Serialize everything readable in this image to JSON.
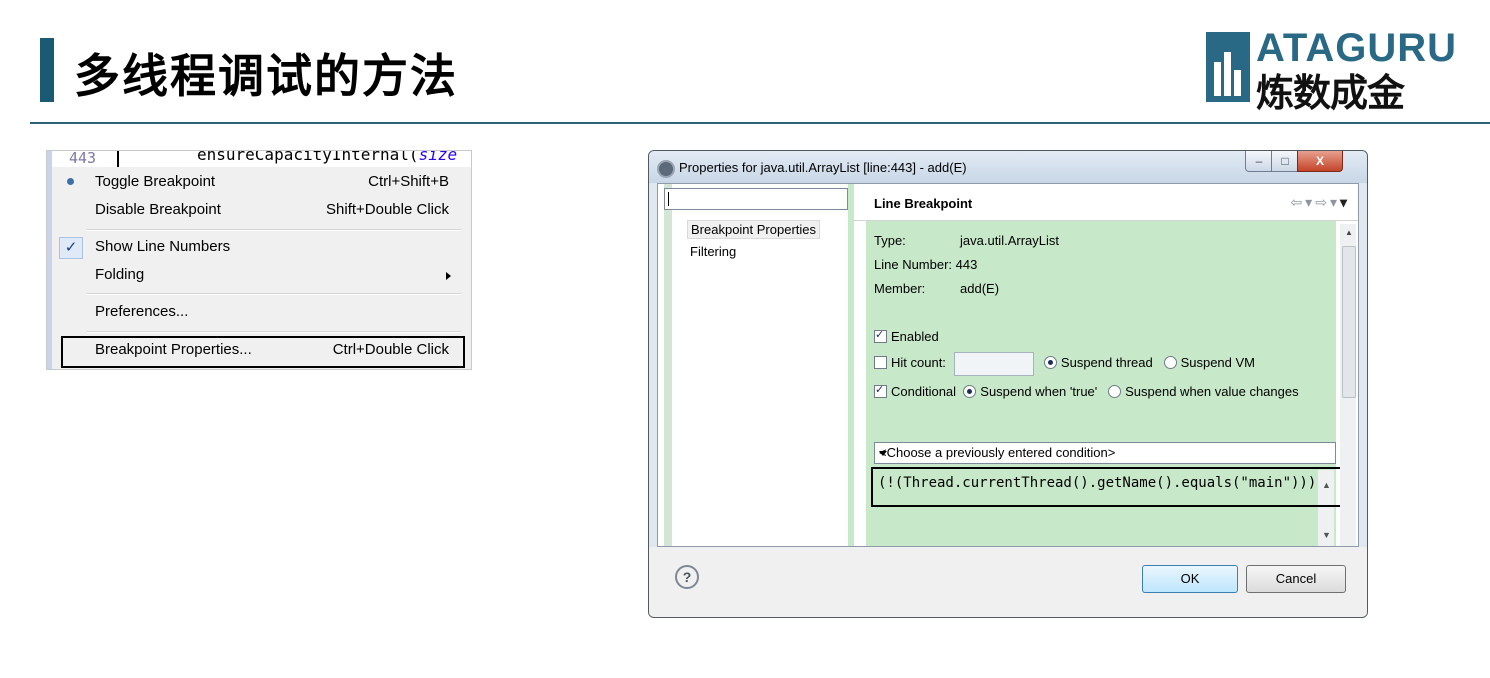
{
  "slide": {
    "title": "多线程调试的方法",
    "logo_en": "ATAGURU",
    "logo_cn": "炼数成金"
  },
  "context_menu": {
    "code_line_number": "443",
    "code_text": "ensureCapacityInternal(",
    "code_text_tail": "size",
    "items": [
      {
        "label": "Toggle Breakpoint",
        "shortcut": "Ctrl+Shift+B",
        "icon": "breakpoint-dot-icon"
      },
      {
        "label": "Disable Breakpoint",
        "shortcut": "Shift+Double Click"
      },
      {
        "label": "Show Line Numbers",
        "shortcut": "",
        "icon": "checkmark-icon",
        "checked": true
      },
      {
        "label": "Folding",
        "shortcut": "",
        "submenu": true
      },
      {
        "label": "Preferences...",
        "shortcut": ""
      },
      {
        "label": "Breakpoint Properties...",
        "shortcut": "Ctrl+Double Click",
        "highlighted": true
      }
    ]
  },
  "dialog": {
    "title": "Properties for java.util.ArrayList [line:443] - add(E)",
    "window_buttons": {
      "minimize": "–",
      "maximize": "□",
      "close": "X"
    },
    "nav": {
      "filter_value": "",
      "items": [
        "Breakpoint Properties",
        "Filtering"
      ]
    },
    "page": {
      "heading": "Line Breakpoint",
      "type_label": "Type:",
      "type_value": "java.util.ArrayList",
      "line_label": "Line Number:",
      "line_value": "443",
      "member_label": "Member:",
      "member_value": "add(E)",
      "enabled_label": "Enabled",
      "enabled": true,
      "hit_count_label": "Hit count:",
      "hit_count_value": "",
      "hit_count_checked": false,
      "suspend_thread_label": "Suspend thread",
      "suspend_vm_label": "Suspend VM",
      "suspend_mode": "thread",
      "conditional_label": "Conditional",
      "conditional": true,
      "suspend_true_label": "Suspend when 'true'",
      "suspend_changes_label": "Suspend when value changes",
      "condition_mode": "true",
      "condition_history_placeholder": "<Choose a previously entered condition>",
      "condition_text": "(!(Thread.currentThread().getName().equals(\"main\")))"
    },
    "footer": {
      "help": "?",
      "ok": "OK",
      "cancel": "Cancel"
    }
  },
  "colors": {
    "accent_bar": "#1a5a73",
    "editor_green": "#c8e8ca",
    "logo_blue": "#2a6985"
  }
}
